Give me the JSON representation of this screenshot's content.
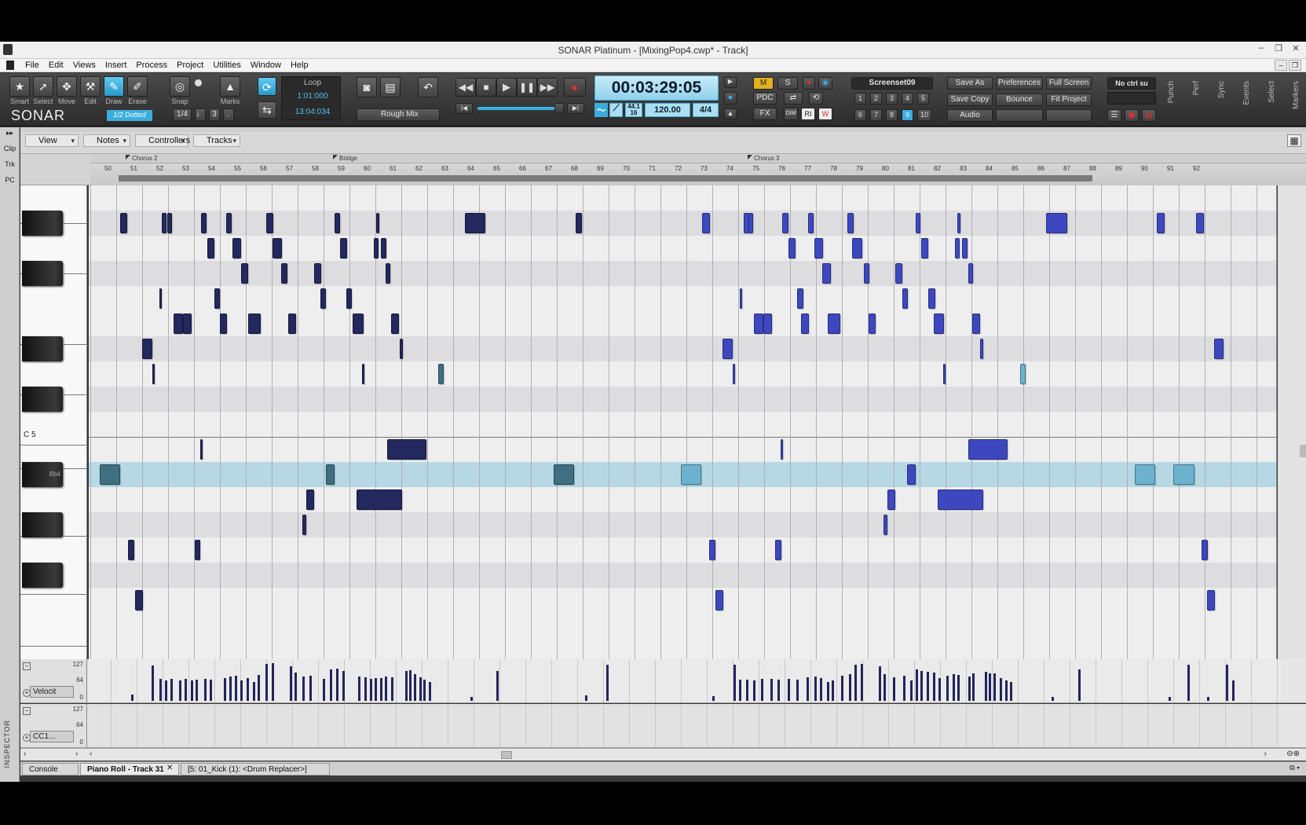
{
  "window": {
    "title": "SONAR Platinum - [MixingPop4.cwp* - Track]",
    "buttons": [
      "–",
      "❐",
      "✕"
    ]
  },
  "menu": [
    "File",
    "Edit",
    "Views",
    "Insert",
    "Process",
    "Project",
    "Utilities",
    "Window",
    "Help"
  ],
  "controlbar": {
    "tools": [
      {
        "icon": "star-icon",
        "label": "Smart"
      },
      {
        "icon": "arrow-icon",
        "label": "Select"
      },
      {
        "icon": "move-icon",
        "label": "Move"
      },
      {
        "icon": "wrench-icon",
        "label": "Edit"
      },
      {
        "icon": "draw-icon",
        "label": "Draw",
        "active": true
      },
      {
        "icon": "pencil-icon",
        "label": "Erase"
      }
    ],
    "brand": "SONAR",
    "draw_dur": "1/2 Dotted",
    "snap_label": "Snap",
    "marks_label": "Marks",
    "snap_value": "1/4",
    "snap_extra": "3",
    "loop_label": "Loop",
    "loop_start": "1:01:000",
    "loop_end": "13:04:034",
    "mix_recall": "Rough Mix",
    "time": "00:03:29:05",
    "sample_rate": "44.1",
    "bit_depth": "16",
    "tempo": "120.00",
    "meter": "4/4",
    "mix_btns": [
      "M",
      "S",
      "PDC",
      "FX"
    ],
    "mix_extras": [
      "DIM",
      "RI",
      "W"
    ],
    "screenset_name": "Screenset09",
    "screensets": [
      "1",
      "2",
      "3",
      "4",
      "5",
      "6",
      "7",
      "8",
      "9",
      "10"
    ],
    "screenset_active": "9",
    "file_btns": [
      "Save As",
      "Preferences",
      "Full Screen",
      "Save Copy",
      "Bounce",
      "Fit Project",
      "Audio"
    ],
    "ctrl_surface": "No ctrl su",
    "side_labels": [
      "Punch",
      "Perf",
      "Sync",
      "Events",
      "Select",
      "Markers"
    ]
  },
  "lefttabs": [
    "Clip",
    "Trk",
    "PC"
  ],
  "inspector": "INSPECTOR",
  "pr_menus": [
    "View",
    "Notes",
    "Controllers",
    "Tracks"
  ],
  "timeline": {
    "markers": [
      {
        "label": "Chorus 2",
        "bar": 51
      },
      {
        "label": "Bridge",
        "bar": 59
      },
      {
        "label": "Chorus 3",
        "bar": 75
      }
    ],
    "bars": [
      50,
      51,
      52,
      53,
      54,
      55,
      56,
      57,
      58,
      59,
      60,
      61,
      62,
      63,
      64,
      65,
      66,
      67,
      68,
      69,
      70,
      71,
      72,
      73,
      74,
      75,
      76,
      77,
      78,
      79,
      80,
      81,
      82,
      83,
      84,
      85,
      86,
      87,
      88,
      89,
      90,
      91,
      92
    ]
  },
  "keyboard": {
    "c5_label": "C 5",
    "bb4_label": "Bb4"
  },
  "controllers": [
    {
      "name": "Velocit",
      "max": "127",
      "mid": "64",
      "min": "0"
    },
    {
      "name": "CC1...",
      "max": "127",
      "mid": "64",
      "min": "0"
    }
  ],
  "bottom_tabs": [
    "Console",
    "Piano Roll - Track 31",
    "[5: 01_Kick (1): <Drum Replacer>]"
  ],
  "colors": {
    "note_dark": "#23285e",
    "note_blue": "#3d48c0",
    "note_teal": "#3f6f80",
    "note_light": "#6cb2cf",
    "accent": "#3aaee0"
  }
}
